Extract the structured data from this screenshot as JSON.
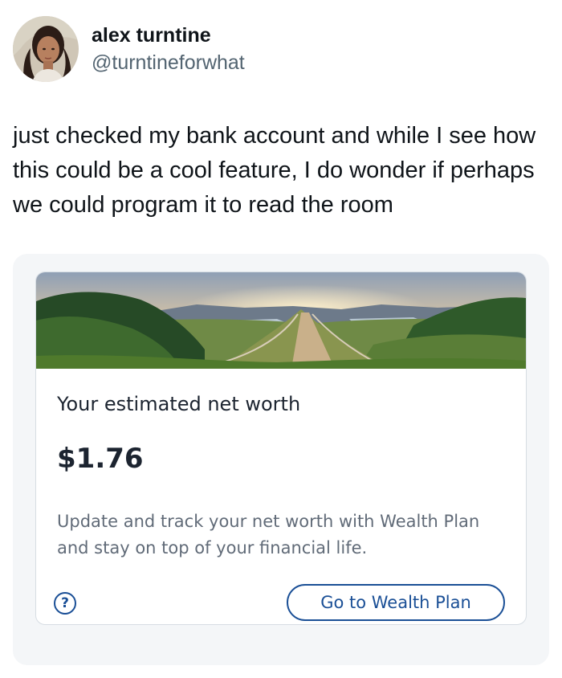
{
  "tweet": {
    "author": {
      "display_name": "alex turntine",
      "handle": "@turntineforwhat"
    },
    "text": "just checked my bank account and while I see how this could be a cool feature, I do wonder if perhaps we could program it to read the room"
  },
  "attachment": {
    "card": {
      "banner_image": "mountain-valley-path-landscape",
      "title": "Your estimated net worth",
      "amount": "$1.76",
      "description": "Update and track your net worth with Wealth Plan and stay on top of your financial life.",
      "help_icon": "question-circle-icon",
      "help_glyph": "?",
      "cta_label": "Go to Wealth Plan"
    },
    "colors": {
      "brand_blue": "#1a4f96",
      "attachment_bg": "#f4f6f8",
      "description_text": "#616b78"
    }
  }
}
